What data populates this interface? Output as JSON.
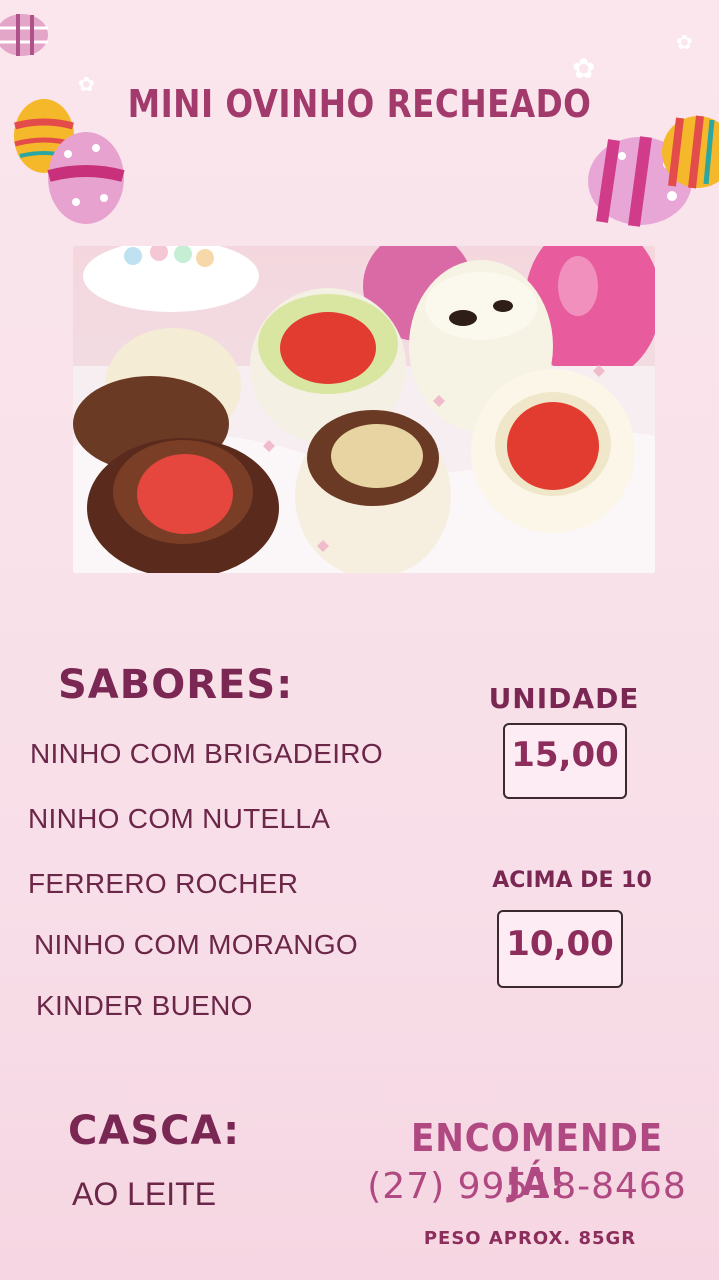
{
  "title": "MINI OVINHO RECHEADO",
  "flavors": {
    "heading": "SABORES:",
    "items": [
      "NINHO COM BRIGADEIRO",
      "NINHO COM NUTELLA",
      "FERRERO ROCHER",
      "NINHO COM MORANGO",
      "KINDER BUENO"
    ]
  },
  "pricing": {
    "unit_label": "UNIDADE",
    "unit_price": "15,00",
    "bulk_label": "ACIMA DE 10",
    "bulk_price": "10,00"
  },
  "shell": {
    "heading": "CASCA:",
    "value": "AO LEITE"
  },
  "contact": {
    "cta": "ENCOMENDE JÁ!",
    "phone": "(27) 99518-8468",
    "weight_note": "PESO APROX. 85GR"
  },
  "colors": {
    "background": "#fbe6ee",
    "accent": "#a23a6b",
    "dark_text": "#7a2753",
    "phone_pink": "#b04882"
  },
  "icons": [
    "easter-egg-icon",
    "daisy-icon"
  ]
}
